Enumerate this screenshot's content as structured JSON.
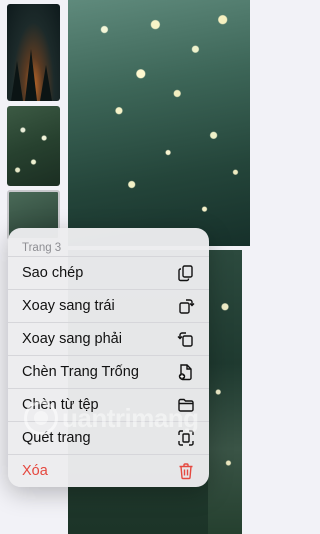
{
  "menu": {
    "header": "Trang 3",
    "items": [
      {
        "label": "Sao chép",
        "icon": "copy-icon"
      },
      {
        "label": "Xoay sang trái",
        "icon": "rotate-left-icon"
      },
      {
        "label": "Xoay sang phải",
        "icon": "rotate-right-icon"
      },
      {
        "label": "Chèn Trang Trống",
        "icon": "insert-blank-page-icon"
      },
      {
        "label": "Chèn từ tệp",
        "icon": "folder-icon"
      },
      {
        "label": "Quét trang",
        "icon": "scan-document-icon"
      },
      {
        "label": "Xóa",
        "icon": "trash-icon"
      }
    ]
  },
  "watermark": {
    "text": "uantrimang"
  },
  "colors": {
    "destructive": "#e5483f",
    "header_text": "#8e8e93"
  }
}
